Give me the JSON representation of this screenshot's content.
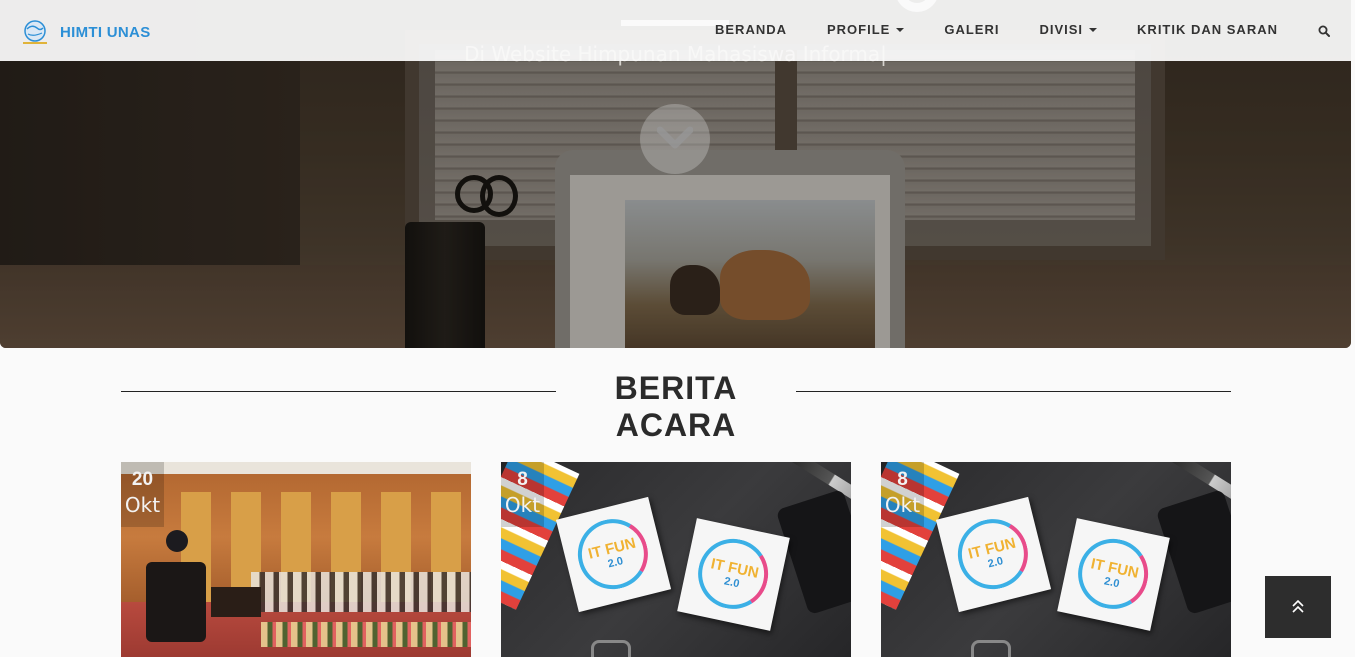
{
  "brand": {
    "name": "HIMTI UNAS",
    "logo_icon": "globe-logo-icon"
  },
  "nav": {
    "items": [
      {
        "label": "BERANDA",
        "dropdown": false
      },
      {
        "label": "PROFILE",
        "dropdown": true
      },
      {
        "label": "GALERI",
        "dropdown": false
      },
      {
        "label": "DIVISI",
        "dropdown": true
      },
      {
        "label": "KRITIK DAN SARAN",
        "dropdown": false
      }
    ],
    "search_icon": "search-icon"
  },
  "hero": {
    "subtitle": "Di Website Himpunan Mahasiswa Informa|",
    "scroll_icon": "chevron-down-icon"
  },
  "section": {
    "title": "BERITA ACARA"
  },
  "cards": [
    {
      "day": "20",
      "month": "Okt"
    },
    {
      "day": "8",
      "month": "Okt",
      "sticker_text": "IT FUN",
      "sticker_version": "2.0"
    },
    {
      "day": "8",
      "month": "Okt",
      "sticker_text": "IT FUN",
      "sticker_version": "2.0"
    }
  ],
  "back_to_top_icon": "double-chevron-up-icon",
  "colors": {
    "brand": "#2c8fd6",
    "nav_text": "#333333",
    "back_to_top": "#2d2d2d"
  }
}
